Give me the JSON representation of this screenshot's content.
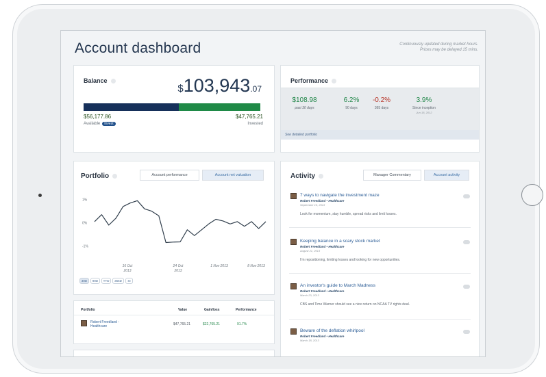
{
  "header": {
    "title": "Account dashboard",
    "note_line1": "Continuously updated during market hours.",
    "note_line2": "Prices may be delayed 15 mins."
  },
  "balance": {
    "heading": "Balance",
    "currency": "$",
    "amount_main": "103,943",
    "amount_cents": ".07",
    "available_value": "$56,177.86",
    "available_label": "Available",
    "invest_label": "Invest",
    "invested_value": "$47,765.21",
    "invested_label": "Invested",
    "available_fraction": 0.54,
    "colors": {
      "available": "#16305a",
      "invested": "#1f8a47"
    }
  },
  "performance": {
    "heading": "Performance",
    "items": [
      {
        "value": "$108.98",
        "label": "past 30 days",
        "sub": ""
      },
      {
        "value": "6.2%",
        "label": "90 days",
        "sub": ""
      },
      {
        "value": "-0.2%",
        "label": "365 days",
        "sub": ""
      },
      {
        "value": "3.9%",
        "label": "Since inception",
        "sub": "Jun 18, 2012"
      }
    ],
    "link": "See detailed portfolio"
  },
  "portfolio": {
    "heading": "Portfolio",
    "tabs": [
      "Account performance",
      "Account net valuation"
    ],
    "active_tab": 1,
    "ranges": [
      "30D",
      "90D",
      "YTD",
      "365D",
      "SI"
    ],
    "active_range": 0,
    "chart_data": {
      "type": "line",
      "ylabels": [
        "1%",
        "0%",
        "-1%"
      ],
      "ylim": [
        -1.6,
        1.4
      ],
      "xlabels": [
        "16 Oct\n2013",
        "24 Oct\n2013",
        "1 Nov 2013",
        "8 Nov 2013"
      ],
      "series": [
        {
          "values": [
            0.05,
            0.35,
            -0.1,
            0.2,
            0.7,
            0.85,
            0.95,
            0.6,
            0.5,
            0.3,
            -0.85,
            -0.83,
            -0.82,
            -0.3,
            -0.55,
            -0.3,
            -0.05,
            0.15,
            0.08,
            -0.05,
            0.05,
            -0.15,
            0.05,
            -0.25,
            0.05
          ]
        }
      ]
    },
    "table": {
      "headers": [
        "Portfolio",
        "Value",
        "Gain/loss",
        "Performance"
      ],
      "rows": [
        {
          "name_line1": "Robert Freedland -",
          "name_line2": "Healthcare",
          "value": "$47,765.21",
          "gain": "$22,765.21",
          "perf": "91.7%"
        }
      ]
    }
  },
  "activity": {
    "heading": "Activity",
    "tabs": [
      "Manager Commentary",
      "Account activity"
    ],
    "active_tab": 1,
    "items": [
      {
        "title": "7 ways to navigate the investment maze",
        "author": "Robert Freedland • Healthcare",
        "date": "September 10, 2013",
        "excerpt": "Look for momentum, stay humble, spread risks and limit losses."
      },
      {
        "title": "Keeping balance in a scary stock market",
        "author": "Robert Freedland • Healthcare",
        "date": "August 21, 2013",
        "excerpt": "I'm repositioning, limiting losses and looking for new opportunities."
      },
      {
        "title": "An investor's guide to March Madness",
        "author": "Robert Freedland • Healthcare",
        "date": "March 20, 2013",
        "excerpt": "CBS and Time Warner should see a nice return on NCAA TV rights deal."
      },
      {
        "title": "Beware of the deflation whirlpool",
        "author": "Robert Freedland • Healthcare",
        "date": "March 18, 2013",
        "excerpt": ""
      }
    ]
  }
}
